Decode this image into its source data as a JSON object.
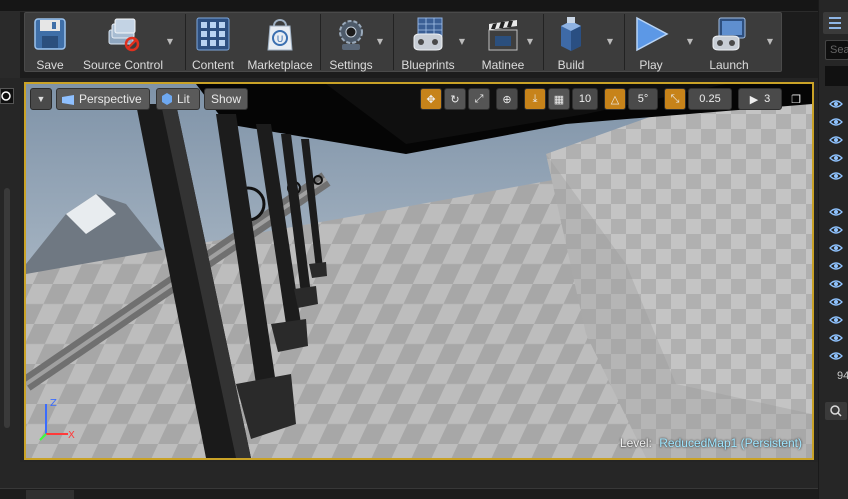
{
  "toolbar": {
    "buttons": [
      {
        "label": "Save",
        "icon": "save-icon"
      },
      {
        "label": "Source Control",
        "icon": "source-control-icon"
      },
      {
        "label": "Content",
        "icon": "content-icon"
      },
      {
        "label": "Marketplace",
        "icon": "marketplace-icon"
      },
      {
        "label": "Settings",
        "icon": "settings-icon"
      },
      {
        "label": "Blueprints",
        "icon": "blueprints-icon"
      },
      {
        "label": "Matinee",
        "icon": "matinee-icon"
      },
      {
        "label": "Build",
        "icon": "build-icon"
      },
      {
        "label": "Play",
        "icon": "play-icon"
      },
      {
        "label": "Launch",
        "icon": "launch-icon"
      }
    ]
  },
  "viewport": {
    "view_mode": "Perspective",
    "lighting": "Lit",
    "show": "Show",
    "grid_snap": "10",
    "rotation_snap": "5°",
    "scale_snap": "0.25",
    "camera_speed": "3",
    "level_label": "Level:",
    "level_name": "ReducedMap1 (Persistent)",
    "axis_labels": {
      "z": "Z",
      "x": "X"
    },
    "accent_color": "#c9a227",
    "snap_color": "#c7831a"
  },
  "right_panel": {
    "search_placeholder": "Sea",
    "count": "94"
  }
}
